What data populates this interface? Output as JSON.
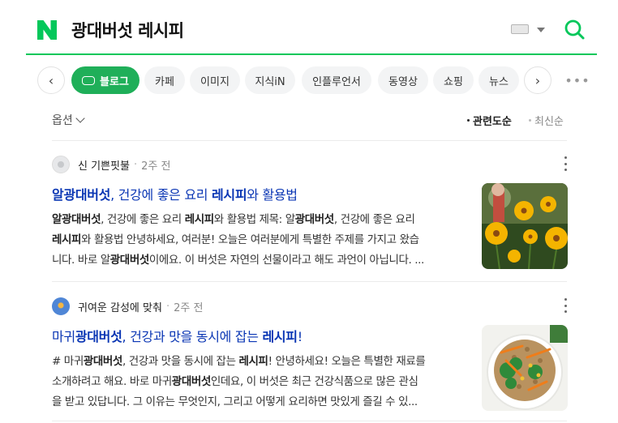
{
  "header": {
    "query": "광대버섯 레시피",
    "brand_color": "#03c75a"
  },
  "tabs": [
    {
      "label": "블로그",
      "active": true
    },
    {
      "label": "카페"
    },
    {
      "label": "이미지"
    },
    {
      "label": "지식iN"
    },
    {
      "label": "인플루언서"
    },
    {
      "label": "동영상"
    },
    {
      "label": "쇼핑"
    },
    {
      "label": "뉴스"
    }
  ],
  "options": {
    "label": "옵션",
    "sort_relevance": "관련도순",
    "sort_latest": "최신순"
  },
  "results": [
    {
      "author": "신 기쁜핏불",
      "time": "2주 전",
      "title": [
        {
          "t": "알광대버섯",
          "b": true
        },
        {
          "t": ", 건강에 좋은 요리 ",
          "b": false
        },
        {
          "t": "레시피",
          "b": true
        },
        {
          "t": "와 활용법",
          "b": false
        }
      ],
      "desc": [
        [
          {
            "t": "알광대버섯",
            "b": true
          },
          {
            "t": ", 건강에 좋은 요리 ",
            "b": false
          },
          {
            "t": "레시피",
            "b": true
          },
          {
            "t": "와 활용법 제목: 알",
            "b": false
          },
          {
            "t": "광대버섯",
            "b": true
          },
          {
            "t": ", 건강에 좋은 요리",
            "b": false
          }
        ],
        [
          {
            "t": "레시피",
            "b": true
          },
          {
            "t": "와 활용법 안녕하세요, 여러분! 오늘은 여러분에게 특별한 주제를 가지고 왔습",
            "b": false
          }
        ],
        [
          {
            "t": "니다. 바로 알",
            "b": false
          },
          {
            "t": "광대버섯",
            "b": true
          },
          {
            "t": "이에요. 이 버섯은 자연의 선물이라고 해도 과언이 아닙니다. ...",
            "b": false
          }
        ]
      ]
    },
    {
      "author": "귀여운 감성에 맞춰",
      "time": "2주 전",
      "title": [
        {
          "t": "마귀",
          "b": false
        },
        {
          "t": "광대버섯",
          "b": true
        },
        {
          "t": ", 건강과 맛을 동시에 잡는 ",
          "b": false
        },
        {
          "t": "레시피",
          "b": true
        },
        {
          "t": "!",
          "b": false
        }
      ],
      "desc": [
        [
          {
            "t": "# 마귀",
            "b": false
          },
          {
            "t": "광대버섯",
            "b": true
          },
          {
            "t": ", 건강과 맛을 동시에 잡는 ",
            "b": false
          },
          {
            "t": "레시피",
            "b": true
          },
          {
            "t": "! 안녕하세요! 오늘은 특별한 재료를",
            "b": false
          }
        ],
        [
          {
            "t": "소개하려고 해요. 바로 마귀",
            "b": false
          },
          {
            "t": "광대버섯",
            "b": true
          },
          {
            "t": "인데요, 이 버섯은 최근 건강식품으로 많은 관심",
            "b": false
          }
        ],
        [
          {
            "t": "을 받고 있답니다. 그 이유는 무엇인지, 그리고 어떻게 요리하면 맛있게 즐길 수 있...",
            "b": false
          }
        ]
      ]
    }
  ],
  "colors": {
    "link": "#0a36b4",
    "active_tab": "#1faf59"
  }
}
